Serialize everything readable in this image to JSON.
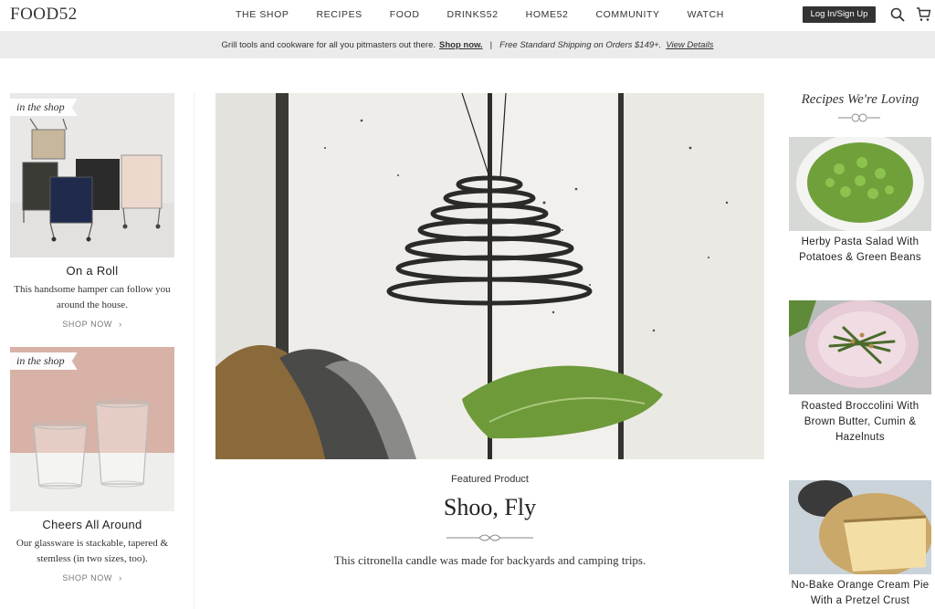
{
  "header": {
    "logo": "FOOD52",
    "nav": [
      "THE SHOP",
      "RECIPES",
      "FOOD",
      "DRINKS52",
      "HOME52",
      "COMMUNITY",
      "WATCH"
    ],
    "login_label": "Log In/Sign Up",
    "search_icon": "search-icon",
    "cart_icon": "cart-icon"
  },
  "promo": {
    "text": "Grill tools and cookware for all you pitmasters out there.",
    "shop_link": "Shop now.",
    "separator": "|",
    "shipping": "Free Standard Shipping on Orders $149+.",
    "details_link": "View Details"
  },
  "left": {
    "cards": [
      {
        "tag": "in the shop",
        "title": "On a Roll",
        "desc": "This handsome hamper can follow you around the house.",
        "cta": "SHOP NOW"
      },
      {
        "tag": "in the shop",
        "title": "Cheers All Around",
        "desc": "Our glassware is stackable, tapered & stemless (in two sizes, too).",
        "cta": "SHOP NOW"
      }
    ]
  },
  "featured": {
    "label": "Featured Product",
    "title": "Shoo, Fly",
    "desc": "This citronella candle was made for backyards and camping trips."
  },
  "right": {
    "title": "Recipes We're Loving",
    "recipes": [
      {
        "title": "Herby Pasta Salad With Potatoes & Green Beans"
      },
      {
        "title": "Roasted Broccolini With Brown Butter, Cumin & Hazelnuts"
      },
      {
        "title": "No-Bake Orange Cream Pie With a Pretzel Crust"
      }
    ]
  },
  "colors": {
    "promo_bg": "#ebebeb",
    "login_bg": "#333333",
    "text": "#333333"
  }
}
